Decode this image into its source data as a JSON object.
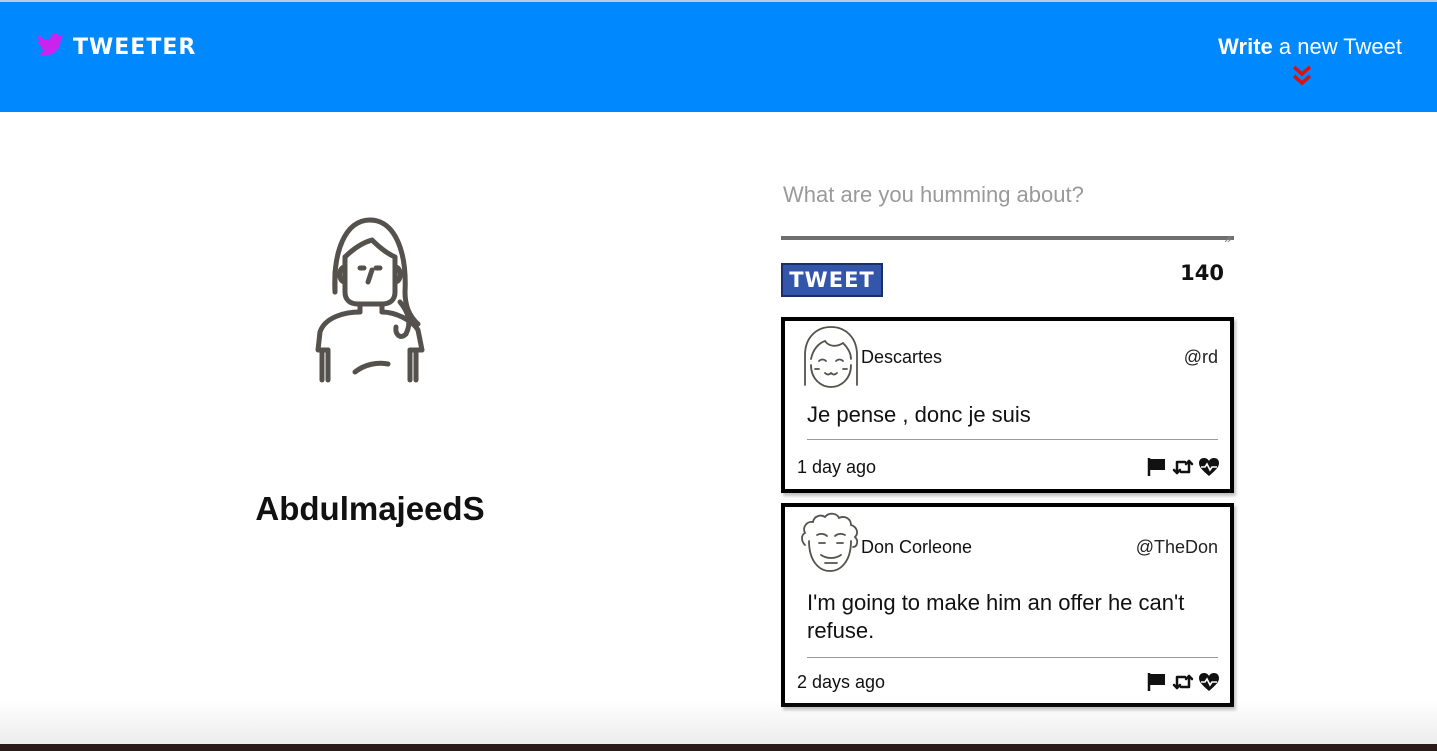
{
  "nav": {
    "brand": "TWEETER",
    "compose_bold": "Write",
    "compose_rest": " a new Tweet"
  },
  "colors": {
    "navbar": "#0088ff",
    "brand_icon": "#cc22ee",
    "arrow": "#dd1111",
    "tweet_button": "#3355aa"
  },
  "profile": {
    "username": "AbdulmajeedS"
  },
  "composer": {
    "placeholder": "What are you humming about?",
    "button_label": "TWEET",
    "char_count": "140"
  },
  "tweets": [
    {
      "name": "Descartes",
      "handle": "@rd",
      "text": "Je pense , donc je suis",
      "time": "1 day ago"
    },
    {
      "name": "Don Corleone",
      "handle": "@TheDon",
      "text": "I'm going to make him an offer he can't refuse.",
      "time": "2 days ago"
    }
  ]
}
